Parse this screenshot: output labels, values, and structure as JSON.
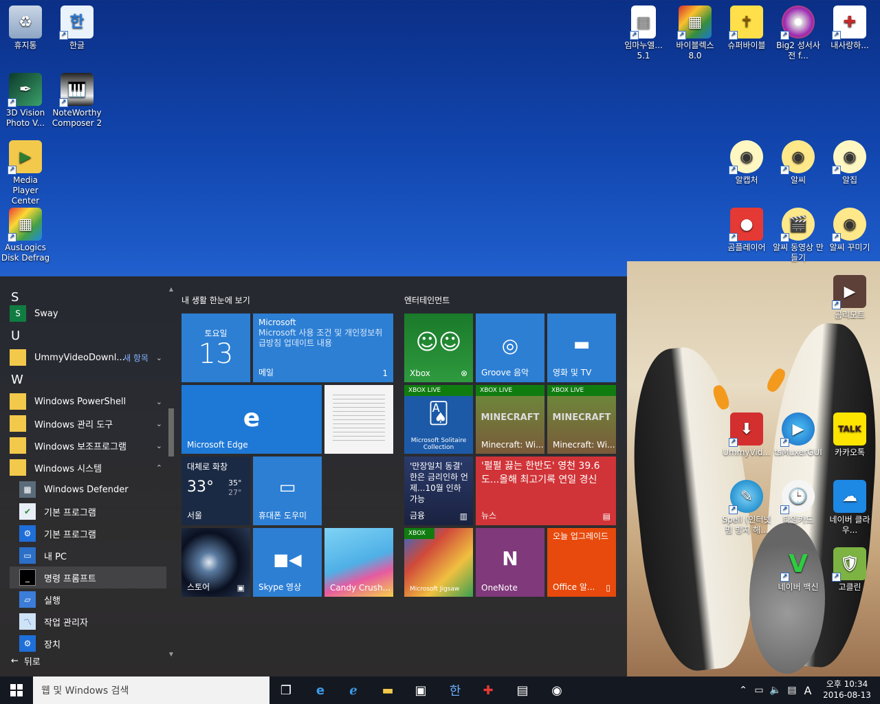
{
  "desktop": {
    "icons": [
      {
        "label": "휴지통",
        "icon": "recycle-bin-icon"
      },
      {
        "label": "한글",
        "icon": "hangul-icon"
      },
      {
        "label": "3D Vision Photo V...",
        "icon": "3d-vision-icon"
      },
      {
        "label": "NoteWorthy Composer 2",
        "icon": "noteworthy-icon"
      },
      {
        "label": "Media Player Center",
        "icon": "media-player-icon"
      },
      {
        "label": "AusLogics Disk Defrag",
        "icon": "defrag-icon"
      },
      {
        "label": "임마누엘... 5.1",
        "icon": "document-icon"
      },
      {
        "label": "바이블렉스 8.0",
        "icon": "biblex-icon"
      },
      {
        "label": "슈퍼바이블",
        "icon": "superbible-icon"
      },
      {
        "label": "Big2 성서사전 f...",
        "icon": "big2-icon"
      },
      {
        "label": "내사랑하...",
        "icon": "bible-book-icon"
      },
      {
        "label": "알캡처",
        "icon": "alcapture-icon"
      },
      {
        "label": "알씨",
        "icon": "alsee-icon"
      },
      {
        "label": "알집",
        "icon": "alzip-icon"
      },
      {
        "label": "곰플레이어",
        "icon": "gomplayer-icon"
      },
      {
        "label": "알씨 동영상 만들기",
        "icon": "alsee-video-icon"
      },
      {
        "label": "알씨 꾸미기",
        "icon": "alsee-deco-icon"
      },
      {
        "label": "곰리모트",
        "icon": "gomremote-icon"
      },
      {
        "label": "UmmyVid...",
        "icon": "ummy-icon"
      },
      {
        "label": "tsMuxerGUI",
        "icon": "tsmuxer-icon"
      },
      {
        "label": "카카오톡",
        "icon": "kakaotalk-icon"
      },
      {
        "label": "Spell (인터넷 펌 방지 해...",
        "icon": "spell-icon"
      },
      {
        "label": "타임카드",
        "icon": "timecard-icon"
      },
      {
        "label": "네이버 클라우...",
        "icon": "naver-cloud-icon"
      },
      {
        "label": "네이버 백신",
        "icon": "naver-vaccine-icon"
      },
      {
        "label": "고클린",
        "icon": "goclean-icon"
      }
    ]
  },
  "start_menu": {
    "letters": {
      "s": "S",
      "u": "U",
      "w": "W"
    },
    "apps": [
      {
        "label": "Sway"
      },
      {
        "label": "UmmyVideoDownl...",
        "tag": "새 항목"
      },
      {
        "label": "Windows PowerShell"
      },
      {
        "label": "Windows 관리 도구"
      },
      {
        "label": "Windows 보조프로그램"
      },
      {
        "label": "Windows 시스템"
      },
      {
        "label": "Windows Defender"
      },
      {
        "label": "기본 프로그램"
      },
      {
        "label": "기본 프로그램"
      },
      {
        "label": "내 PC"
      },
      {
        "label": "명령 프롬프트"
      },
      {
        "label": "실행"
      },
      {
        "label": "작업 관리자"
      },
      {
        "label": "장치"
      }
    ],
    "back_label": "뒤로",
    "groups": {
      "life": "내 생활 한눈에 보기",
      "entertainment": "엔터테인먼트"
    },
    "tiles": {
      "calendar": {
        "day": "토요일",
        "date": "13"
      },
      "mail": {
        "sender": "Microsoft",
        "body": "Microsoft 사용 조건 및 개인정보취급방침 업데이트 내용",
        "label": "메일",
        "count": "1"
      },
      "edge": {
        "label": "Microsoft Edge"
      },
      "weather": {
        "condition": "대체로 화창",
        "temp": "33°",
        "high": "35°",
        "low": "27°",
        "city": "서울"
      },
      "phone": {
        "label": "휴대폰 도우미"
      },
      "store": {
        "label": "스토어"
      },
      "skype": {
        "label": "Skype 영상"
      },
      "candy": {
        "label": "Candy Crush..."
      },
      "xbox": {
        "label": "Xbox"
      },
      "groove": {
        "label": "Groove 음악"
      },
      "movies": {
        "label": "영화 및 TV"
      },
      "solitaire": {
        "badge": "XBOX LIVE",
        "title": "Microsoft Solitaire Collection"
      },
      "minecraft1": {
        "badge": "XBOX LIVE",
        "label": "Minecraft: Wi..."
      },
      "minecraft2": {
        "badge": "XBOX LIVE",
        "label": "Minecraft: Wi..."
      },
      "finance": {
        "headline": "'만장일치 동결' 한은 금리인하 언제...10월 인하 가능",
        "label": "금융"
      },
      "news": {
        "headline": "'펄펄 끓는 한반도' 영천 39.6도...올해 최고기록 연일 경신",
        "label": "뉴스"
      },
      "jigsaw": {
        "badge": "XBOX",
        "label": "Microsoft Jigsaw"
      },
      "onenote": {
        "label": "OneNote"
      },
      "office": {
        "headline": "오늘 업그레이드",
        "label": "Office 알..."
      }
    }
  },
  "taskbar": {
    "search_placeholder": "웹 및 Windows 검색",
    "ime": "A",
    "time": "오후 10:34",
    "date": "2016-08-13"
  }
}
